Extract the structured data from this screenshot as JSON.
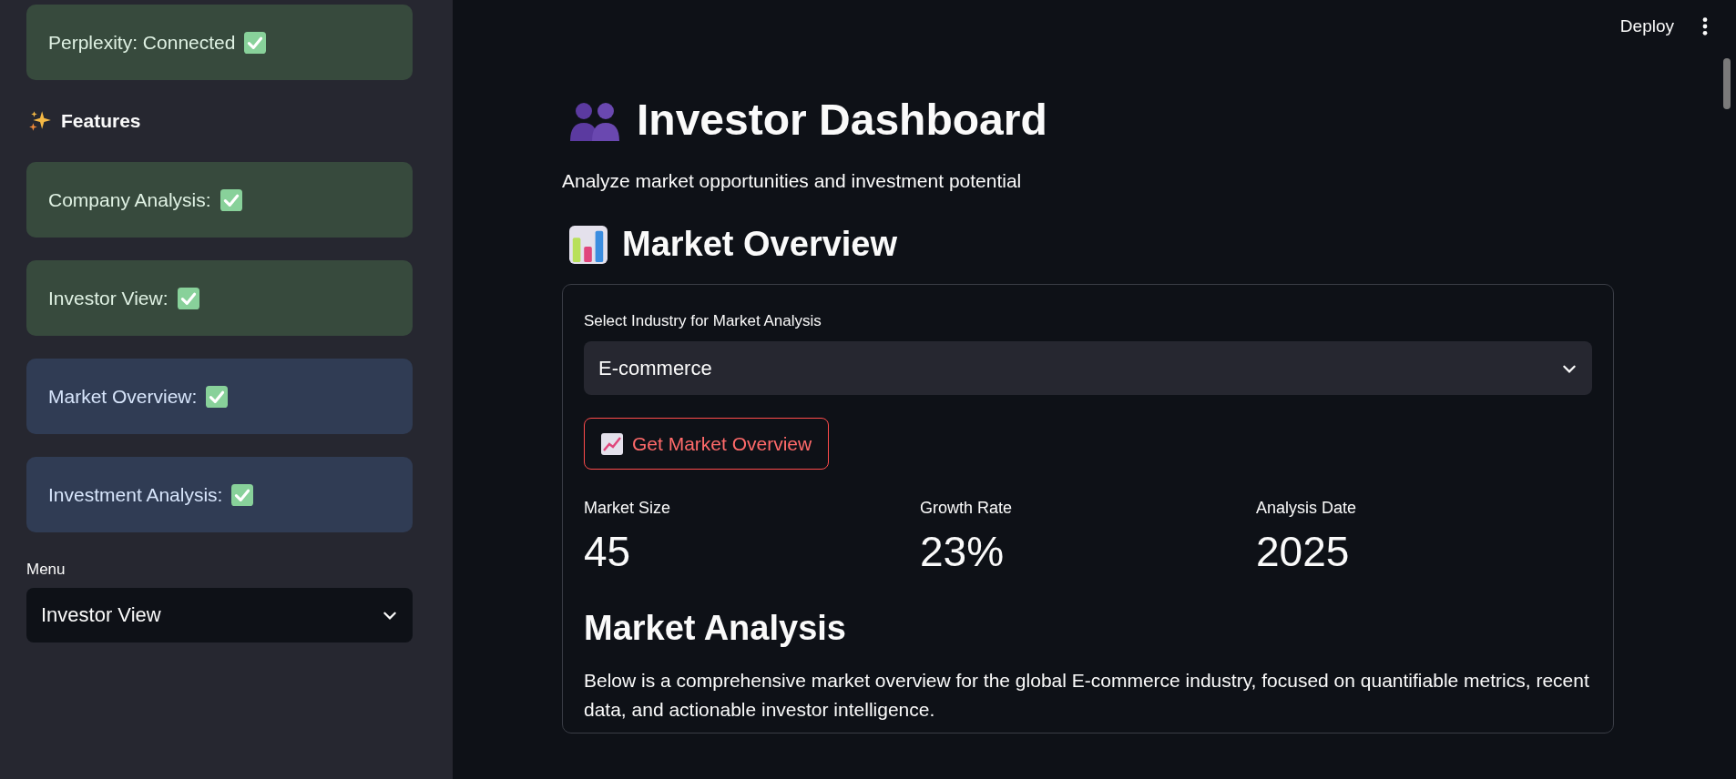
{
  "sidebar": {
    "status_alerts": [
      {
        "kind": "success",
        "text": "Perplexity: Connected"
      }
    ],
    "features_heading": "Features",
    "features": [
      {
        "kind": "success",
        "text": "Company Analysis:"
      },
      {
        "kind": "success",
        "text": "Investor View:"
      },
      {
        "kind": "info",
        "text": "Market Overview:"
      },
      {
        "kind": "info",
        "text": "Investment Analysis:"
      }
    ],
    "menu": {
      "label": "Menu",
      "value": "Investor View"
    }
  },
  "toolbar": {
    "deploy": "Deploy"
  },
  "main": {
    "title": "Investor Dashboard",
    "subtitle": "Analyze market opportunities and investment potential",
    "section_title": "Market Overview",
    "industry_select": {
      "label": "Select Industry for Market Analysis",
      "value": "E-commerce"
    },
    "button": "Get Market Overview",
    "metrics": [
      {
        "label": "Market Size",
        "value": "45"
      },
      {
        "label": "Growth Rate",
        "value": "23%"
      },
      {
        "label": "Analysis Date",
        "value": "2025"
      }
    ],
    "analysis_title": "Market Analysis",
    "analysis_text": "Below is a comprehensive market overview for the global E-commerce industry, focused on quantifiable metrics, recent data, and actionable investor intelligence."
  }
}
